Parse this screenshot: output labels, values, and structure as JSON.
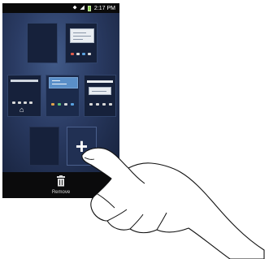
{
  "status_bar": {
    "icons": [
      "signal-icon",
      "wifi-icon",
      "battery-icon"
    ],
    "signal_glyph": "⬥",
    "wifi_glyph": "◢",
    "time": "2:17 PM"
  },
  "home_screen_editor": {
    "panels": [
      "page-1",
      "page-2",
      "page-3",
      "page-4",
      "page-5",
      "page-6",
      "page-7"
    ],
    "home_icon_glyph": "⌂",
    "add_button_glyph": "+"
  },
  "bottom_bar": {
    "remove_label": "Remove"
  },
  "colors": {
    "status_bar_bg": "#0a0a0a",
    "screen_bg": "#2a3b63",
    "battery": "#8bd14a"
  }
}
